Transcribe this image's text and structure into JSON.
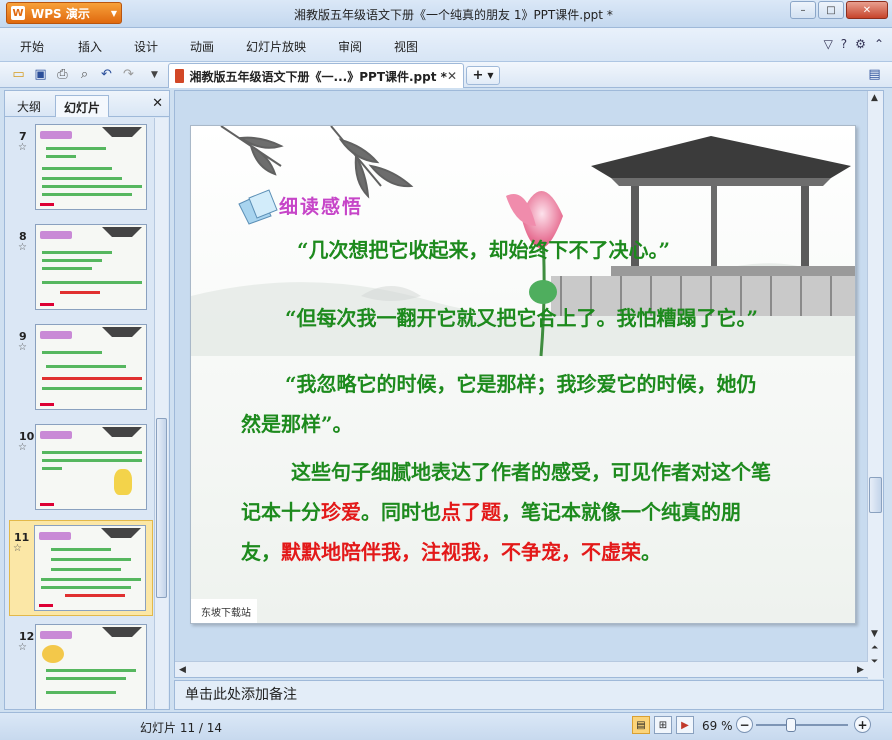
{
  "app": {
    "name": "WPS 演示",
    "window_title": "湘教版五年级语文下册《一个纯真的朋友 1》PPT课件.ppt *"
  },
  "window_controls": {
    "minimize": "–",
    "maximize": "□",
    "close": "✕"
  },
  "menu": {
    "items": [
      "开始",
      "插入",
      "设计",
      "动画",
      "幻灯片放映",
      "审阅",
      "视图"
    ],
    "right_icons": [
      "chevron-down-icon",
      "help-icon",
      "skin-icon",
      "minimize-ribbon-icon"
    ]
  },
  "toolbar": {
    "icons": [
      "open-icon",
      "save-icon",
      "print-icon",
      "print-preview-icon",
      "undo-icon",
      "redo-icon",
      "customize-icon"
    ],
    "doc_tab_label": "湘教版五年级语文下册《一...》PPT课件.ppt *",
    "doc_tab_close": "✕",
    "new_tab": "+"
  },
  "left_panel": {
    "tabs": [
      "大纲",
      "幻灯片"
    ],
    "active_tab": "幻灯片",
    "close": "✕",
    "thumbnails": [
      {
        "number": "7",
        "star": "☆"
      },
      {
        "number": "8",
        "star": "☆"
      },
      {
        "number": "9",
        "star": "☆"
      },
      {
        "number": "10",
        "star": "☆"
      },
      {
        "number": "11",
        "star": "☆",
        "selected": true
      },
      {
        "number": "12",
        "star": "☆"
      }
    ]
  },
  "slide": {
    "heading": "细读感悟",
    "lines": [
      {
        "segments": [
          {
            "text": "“几次想把它收起来，却始终下不了决心。”",
            "color": "green"
          }
        ]
      },
      {
        "segments": [
          {
            "text": "“但每次我一翻开它就又把它合上了。我怕糟蹋了它。”",
            "color": "green"
          }
        ]
      },
      {
        "segments": [
          {
            "text": "“我忽略它的时候，它是那样；我珍爱它的时候，她仍",
            "color": "green"
          }
        ]
      },
      {
        "segments": [
          {
            "text": "然是那样”。",
            "color": "green"
          }
        ]
      },
      {
        "segments": [
          {
            "text": "这些句子细腻地表达了作者的感受，可见作者对这个笔",
            "color": "green"
          }
        ]
      },
      {
        "segments": [
          {
            "text": "记本十分",
            "color": "green"
          },
          {
            "text": "珍爱",
            "color": "red"
          },
          {
            "text": "。同时也",
            "color": "green"
          },
          {
            "text": "点了题",
            "color": "red"
          },
          {
            "text": "，笔记本就像一个纯真的朋",
            "color": "green"
          }
        ]
      },
      {
        "segments": [
          {
            "text": "友，",
            "color": "green"
          },
          {
            "text": "默默地陪伴我，注视我，不争宠，不虚荣",
            "color": "red"
          },
          {
            "text": "。",
            "color": "green"
          }
        ]
      }
    ],
    "footer": "东坡下载站",
    "colors": {
      "green": "#1d8a1d",
      "red": "#e31919",
      "heading": "#c645c8"
    }
  },
  "notes": {
    "placeholder": "单击此处添加备注"
  },
  "statusbar": {
    "slide_info": "幻灯片 11 / 14",
    "zoom": "69 %",
    "zoom_level": 0.38,
    "view_icons": [
      "normal-view-icon",
      "slide-sorter-icon",
      "slideshow-icon"
    ]
  }
}
